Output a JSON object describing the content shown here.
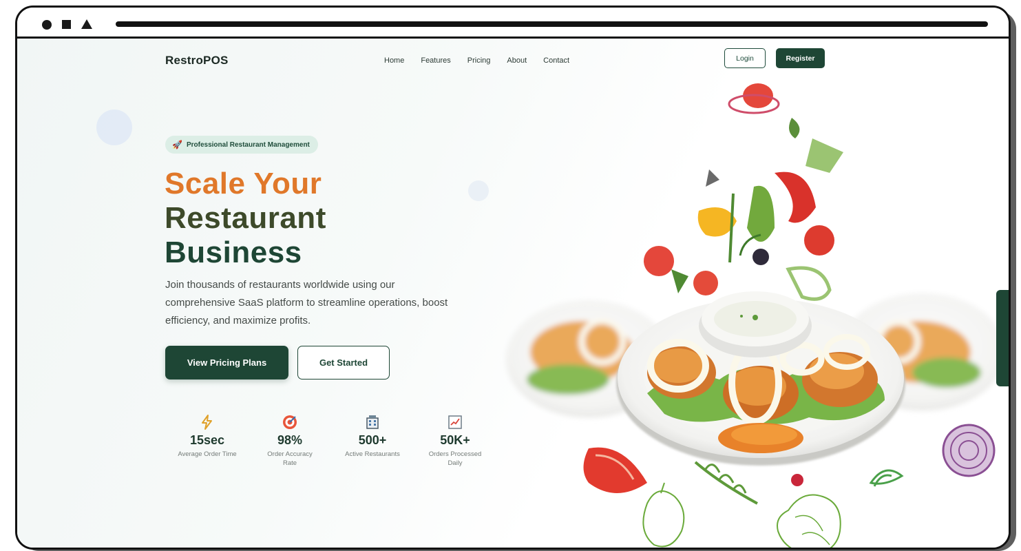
{
  "brand": "RestroPOS",
  "nav": [
    "Home",
    "Features",
    "Pricing",
    "About",
    "Contact"
  ],
  "auth": {
    "login": "Login",
    "register": "Register"
  },
  "hero": {
    "badge": "Professional Restaurant Management",
    "title_line1": "Scale Your",
    "title_line2": "Restaurant",
    "title_line3": "Business",
    "description": "Join thousands of restaurants worldwide using our comprehensive SaaS platform to streamline operations, boost efficiency, and maximize profits.",
    "primary_cta": "View Pricing Plans",
    "secondary_cta": "Get Started"
  },
  "stats": [
    {
      "icon": "lightning-icon",
      "value": "15sec",
      "label": "Average Order Time"
    },
    {
      "icon": "target-icon",
      "value": "98%",
      "label": "Order Accuracy Rate"
    },
    {
      "icon": "building-icon",
      "value": "500+",
      "label": "Active Restaurants"
    },
    {
      "icon": "chart-icon",
      "value": "50K+",
      "label": "Orders Processed Daily"
    }
  ],
  "colors": {
    "brand_green": "#1e4635",
    "accent_orange": "#e0782a",
    "olive": "#3d4a2a",
    "badge_bg": "#dceee6"
  }
}
